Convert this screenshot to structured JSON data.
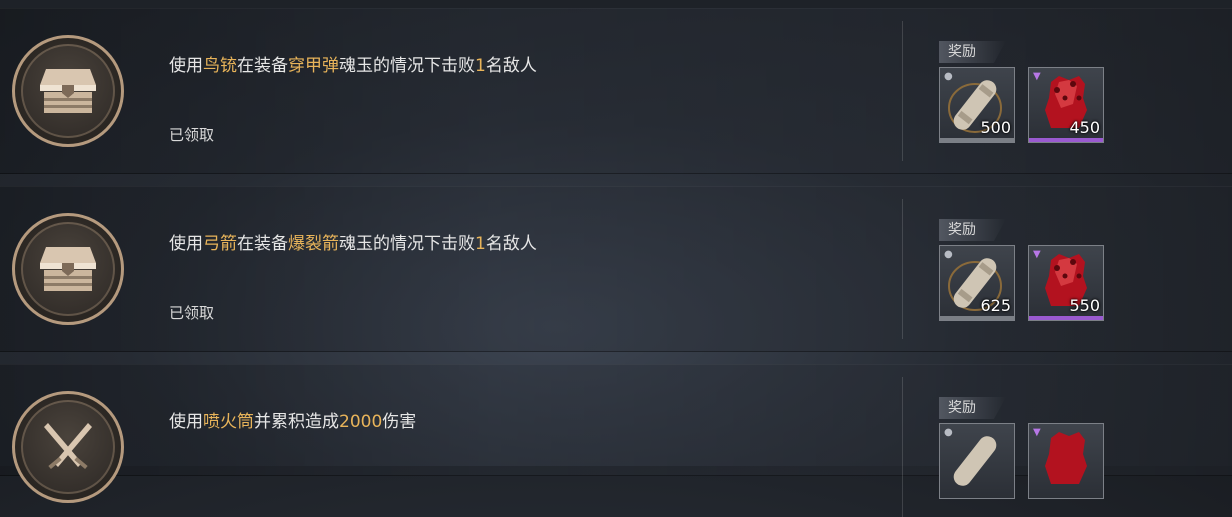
{
  "colors": {
    "highlight": "#e8b45a",
    "medal_border": "#b59a7e",
    "epic_bar": "#9a5ad0",
    "common_bar": "#7b7f86"
  },
  "tasks": [
    {
      "icon": "chest-icon",
      "text": {
        "p1": "使用",
        "h1": "鸟铳",
        "p2": "在装备",
        "h2": "穿甲弹",
        "p3": "魂玉的情况下击败",
        "h3": "1",
        "p4": "名敌人"
      },
      "status": "已领取",
      "reward_label": "奖励",
      "rewards": [
        {
          "icon": "scroll-icon",
          "qty": "500"
        },
        {
          "icon": "red-crystal-icon",
          "qty": "450"
        }
      ]
    },
    {
      "icon": "chest-icon",
      "text": {
        "p1": "使用",
        "h1": "弓箭",
        "p2": "在装备",
        "h2": "爆裂箭",
        "p3": "魂玉的情况下击败",
        "h3": "1",
        "p4": "名敌人"
      },
      "status": "已领取",
      "reward_label": "奖励",
      "rewards": [
        {
          "icon": "scroll-icon",
          "qty": "625"
        },
        {
          "icon": "red-crystal-icon",
          "qty": "550"
        }
      ]
    },
    {
      "icon": "crossed-swords-icon",
      "text": {
        "p1": "使用",
        "h1": "喷火筒",
        "p2": "并累积造成",
        "h2": "2000",
        "p3": "伤害"
      },
      "reward_label": "奖励"
    }
  ]
}
